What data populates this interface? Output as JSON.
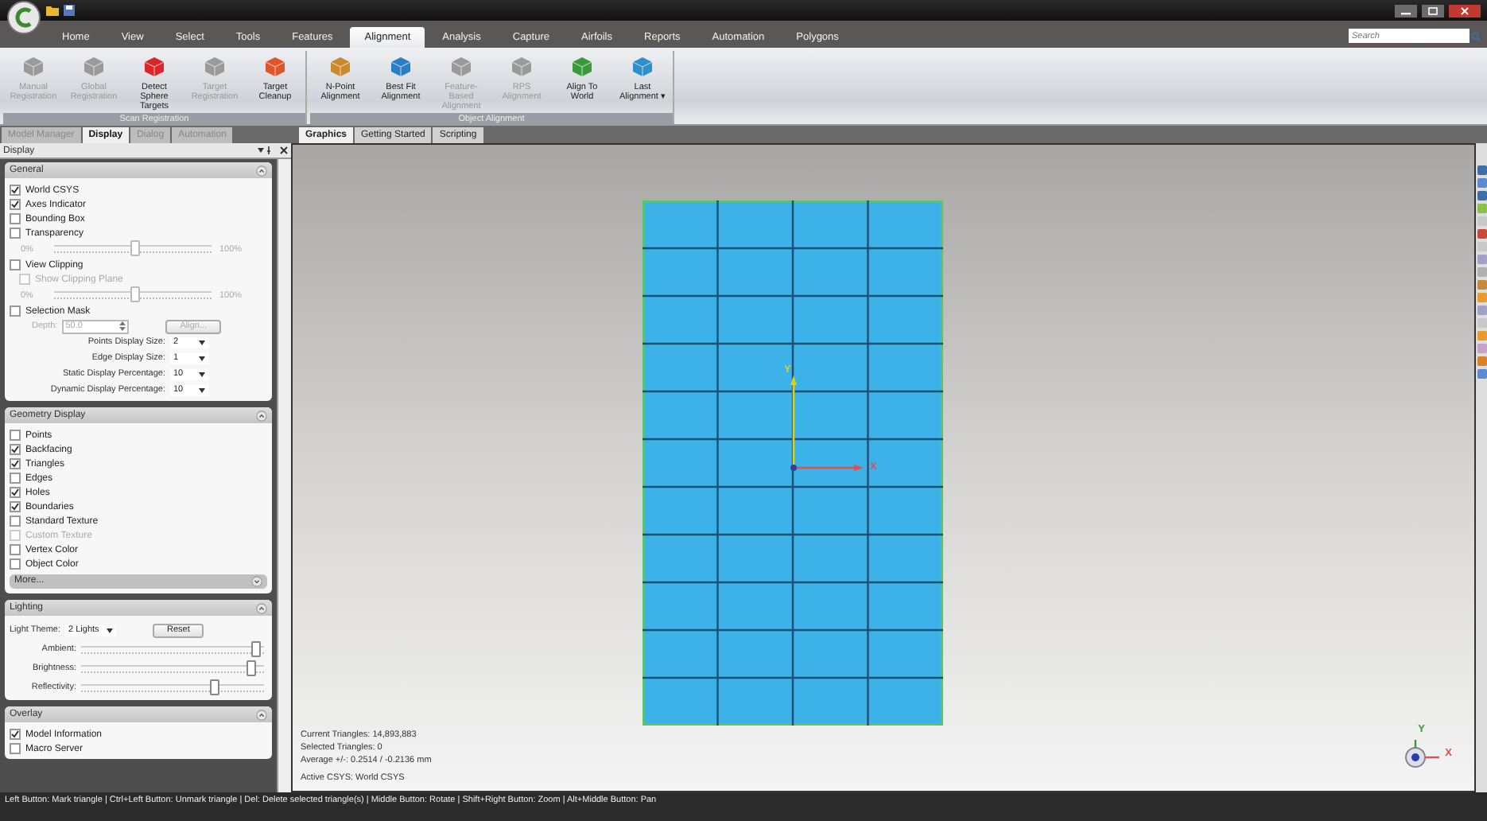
{
  "menu_tabs": [
    {
      "label": "Home",
      "selected": false
    },
    {
      "label": "View",
      "selected": false
    },
    {
      "label": "Select",
      "selected": false
    },
    {
      "label": "Tools",
      "selected": false
    },
    {
      "label": "Features",
      "selected": false
    },
    {
      "label": "Alignment",
      "selected": true
    },
    {
      "label": "Analysis",
      "selected": false
    },
    {
      "label": "Capture",
      "selected": false
    },
    {
      "label": "Airfoils",
      "selected": false
    },
    {
      "label": "Reports",
      "selected": false
    },
    {
      "label": "Automation",
      "selected": false
    },
    {
      "label": "Polygons",
      "selected": false
    }
  ],
  "search": {
    "placeholder": "Search"
  },
  "ribbon_groups": [
    {
      "title": "Scan Registration",
      "buttons": [
        {
          "label": "Manual Registration",
          "disabled": true,
          "color": "#9a9a9a"
        },
        {
          "label": "Global Registration",
          "disabled": true,
          "color": "#9a9a9a"
        },
        {
          "label": "Detect Sphere Targets",
          "disabled": false,
          "color": "#d8262b"
        },
        {
          "label": "Target Registration",
          "disabled": true,
          "color": "#9a9a9a"
        },
        {
          "label": "Target Cleanup",
          "disabled": false,
          "color": "#e0542a"
        }
      ]
    },
    {
      "title": "Object Alignment",
      "buttons": [
        {
          "label": "N-Point Alignment",
          "disabled": false,
          "color": "#c98a2e"
        },
        {
          "label": "Best Fit Alignment",
          "disabled": false,
          "color": "#2a7fc0"
        },
        {
          "label": "Feature-Based Alignment",
          "disabled": true,
          "color": "#9a9a9a"
        },
        {
          "label": "RPS Alignment",
          "disabled": true,
          "color": "#9a9a9a"
        },
        {
          "label": "Align To World",
          "disabled": false,
          "color": "#3a9a3a"
        },
        {
          "label": "Last Alignment ▾",
          "disabled": false,
          "color": "#2f8fc8"
        }
      ]
    }
  ],
  "panel_tabs": [
    {
      "label": "Model Manager",
      "selected": false
    },
    {
      "label": "Display",
      "selected": true
    },
    {
      "label": "Dialog",
      "selected": false
    },
    {
      "label": "Automation",
      "selected": false
    }
  ],
  "panel_title": "Display",
  "sections": [
    {
      "title": "General",
      "expanded": true,
      "rows": [
        {
          "kind": "checkbox",
          "label": "World CSYS",
          "checked": true,
          "disabled": false
        },
        {
          "kind": "checkbox",
          "label": "Axes Indicator",
          "checked": true,
          "disabled": false
        },
        {
          "kind": "checkbox",
          "label": "Bounding Box",
          "checked": false,
          "disabled": false
        },
        {
          "kind": "checkbox",
          "label": "Transparency",
          "checked": false,
          "disabled": false
        },
        {
          "kind": "slider",
          "min": "0%",
          "max": "100%",
          "level": 0.5,
          "disabled": true
        },
        {
          "kind": "checkbox",
          "label": "View Clipping",
          "checked": false,
          "disabled": false,
          "children": [
            {
              "kind": "checkbox",
              "label": "Show Clipping Plane",
              "checked": false,
              "disabled": true
            }
          ]
        },
        {
          "kind": "slider",
          "min": "0%",
          "max": "100%",
          "level": 0.5,
          "disabled": true
        },
        {
          "kind": "checkbox",
          "label": "Selection Mask",
          "checked": false,
          "disabled": false
        },
        {
          "kind": "spin",
          "label": "Depth:",
          "value": "50.0",
          "button": "Align...",
          "disabled": true
        },
        {
          "kind": "select",
          "label": "Points Display Size:",
          "value": "2"
        },
        {
          "kind": "select",
          "label": "Edge Display Size:",
          "value": "1"
        },
        {
          "kind": "select",
          "label": "Static Display Percentage:",
          "value": "10"
        },
        {
          "kind": "select",
          "label": "Dynamic Display Percentage:",
          "value": "10"
        }
      ]
    },
    {
      "title": "Geometry Display",
      "expanded": true,
      "rows": [
        {
          "kind": "checkbox",
          "label": "Points",
          "checked": false,
          "disabled": false
        },
        {
          "kind": "checkbox",
          "label": "Backfacing",
          "checked": true,
          "disabled": false
        },
        {
          "kind": "checkbox",
          "label": "Triangles",
          "checked": true,
          "disabled": false
        },
        {
          "kind": "checkbox",
          "label": "Edges",
          "checked": false,
          "disabled": false
        },
        {
          "kind": "checkbox",
          "label": "Holes",
          "checked": true,
          "disabled": false
        },
        {
          "kind": "checkbox",
          "label": "Boundaries",
          "checked": true,
          "disabled": false
        },
        {
          "kind": "checkbox",
          "label": "Standard Texture",
          "checked": false,
          "disabled": false
        },
        {
          "kind": "checkbox",
          "label": "Custom Texture",
          "checked": false,
          "disabled": true
        },
        {
          "kind": "checkbox",
          "label": "Vertex Color",
          "checked": false,
          "disabled": false
        },
        {
          "kind": "checkbox",
          "label": "Object Color",
          "checked": false,
          "disabled": false
        },
        {
          "kind": "more",
          "label": "More..."
        }
      ]
    },
    {
      "title": "Lighting",
      "expanded": true,
      "rows": [
        {
          "kind": "theme",
          "label": "Light Theme:",
          "value": "2 Lights",
          "button": "Reset"
        },
        {
          "kind": "slider",
          "label": "Ambient:",
          "level": 0.95,
          "disabled": false
        },
        {
          "kind": "slider",
          "label": "Brightness:",
          "level": 0.92,
          "disabled": false
        },
        {
          "kind": "slider",
          "label": "Reflectivity:",
          "level": 0.72,
          "disabled": false
        }
      ]
    },
    {
      "title": "Overlay",
      "expanded": true,
      "rows": [
        {
          "kind": "checkbox",
          "label": "Model Information",
          "checked": true,
          "disabled": false
        },
        {
          "kind": "checkbox",
          "label": "Macro Server",
          "checked": false,
          "disabled": false
        }
      ]
    }
  ],
  "doc_tabs": [
    {
      "label": "Graphics",
      "selected": true
    },
    {
      "label": "Getting Started",
      "selected": false
    },
    {
      "label": "Scripting",
      "selected": false
    }
  ],
  "viewport": {
    "axis_y": "Y",
    "axis_x": "X",
    "info": [
      "Current Triangles: 14,893,883",
      "Selected Triangles: 0",
      "Average +/-: 0.2514 / -0.2136 mm"
    ],
    "active_csys": "Active CSYS: World CSYS",
    "triad_y": "Y",
    "triad_x": "X"
  },
  "status_bar": "Left Button: Mark triangle | Ctrl+Left Button: Unmark triangle | Del: Delete selected triangle(s) | Middle Button: Rotate | Shift+Right Button: Zoom | Alt+Middle Button: Pan"
}
